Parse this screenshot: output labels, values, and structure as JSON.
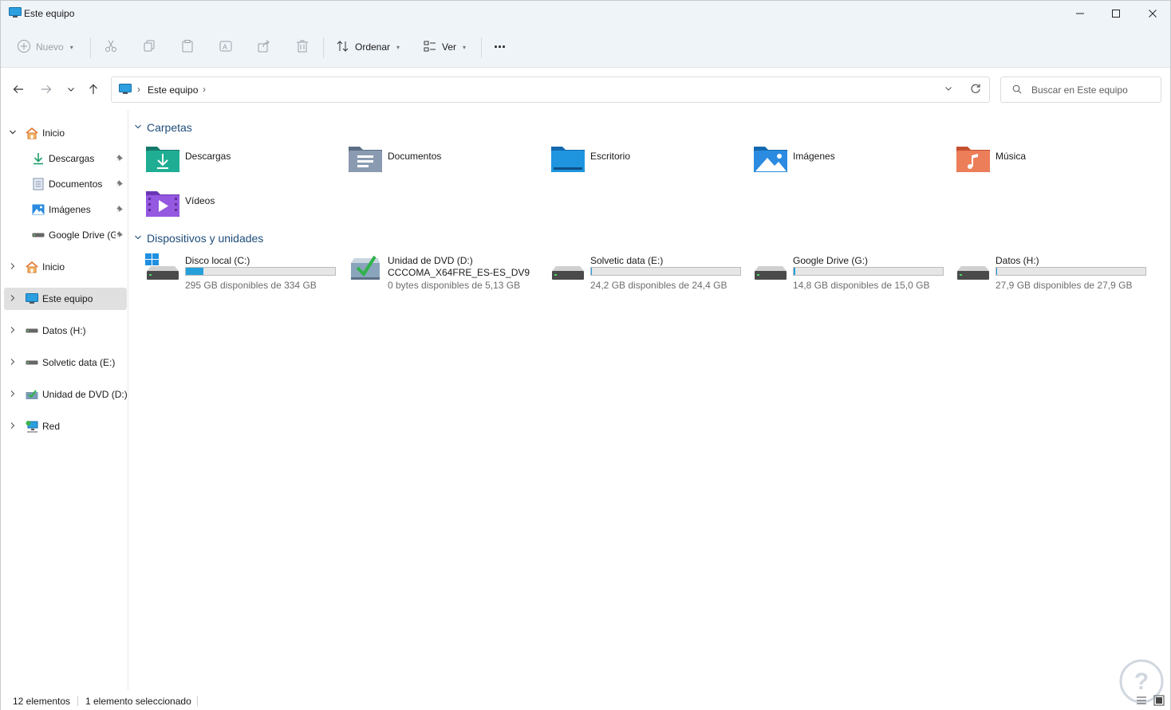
{
  "window": {
    "title": "Este equipo",
    "min_glyph": "─",
    "max_glyph": "☐",
    "close_glyph": "✕"
  },
  "toolbar": {
    "new_label": "Nuevo",
    "sort_label": "Ordenar",
    "view_label": "Ver",
    "more_glyph": "···"
  },
  "nav": {
    "back_glyph": "←",
    "forward_glyph": "→",
    "recent_glyph": "⌄",
    "up_glyph": "↑",
    "breadcrumb": "Este equipo",
    "sep": "›"
  },
  "search": {
    "placeholder": "Buscar en Este equipo"
  },
  "sidebar": {
    "items": [
      {
        "label": "Inicio",
        "expander": "⌄"
      },
      {
        "label": "Descargas"
      },
      {
        "label": "Documentos"
      },
      {
        "label": "Imágenes"
      },
      {
        "label": "Google Drive (G"
      },
      {
        "label": "Inicio",
        "expander": "›"
      },
      {
        "label": "Este equipo",
        "expander": "›"
      },
      {
        "label": "Datos (H:)",
        "expander": "›"
      },
      {
        "label": "Solvetic data (E:)",
        "expander": "›"
      },
      {
        "label": "Unidad de DVD (D:)",
        "expander": "›"
      },
      {
        "label": "Red",
        "expander": "›"
      }
    ],
    "pin_glyph": "📌"
  },
  "content": {
    "folders_title": "Carpetas",
    "devices_title": "Dispositivos y unidades",
    "section_chevron": "⌄",
    "folders": [
      {
        "name": "Descargas",
        "color": "#1e9e8a"
      },
      {
        "name": "Documentos",
        "color": "#7b8fa8"
      },
      {
        "name": "Escritorio",
        "color": "#1b8fd6"
      },
      {
        "name": "Imágenes",
        "color": "#2a8be0"
      },
      {
        "name": "Música",
        "color": "#e26b4c"
      },
      {
        "name": "Vídeos",
        "color": "#8a4fd6"
      }
    ],
    "drives": [
      {
        "name": "Disco local (C:)",
        "free": "295 GB disponibles de 334 GB",
        "used_fraction": 0.117
      },
      {
        "name": "Unidad de DVD (D:)",
        "label2": "CCCOMA_X64FRE_ES-ES_DV9",
        "free": "0 bytes disponibles de 5,13 GB"
      },
      {
        "name": "Solvetic data (E:)",
        "free": "24,2 GB disponibles de 24,4 GB",
        "used_fraction": 0.008
      },
      {
        "name": "Google Drive (G:)",
        "free": "14,8 GB disponibles de 15,0 GB",
        "used_fraction": 0.013
      },
      {
        "name": "Datos (H:)",
        "free": "27,9 GB disponibles de 27,9 GB",
        "used_fraction": 0.002
      }
    ]
  },
  "status": {
    "count": "12 elementos",
    "selection": "1 elemento seleccionado"
  },
  "colors": {
    "accent": "#26a0da",
    "section_heading": "#1e4d7a",
    "toolbar_bg": "#eff4f9"
  }
}
